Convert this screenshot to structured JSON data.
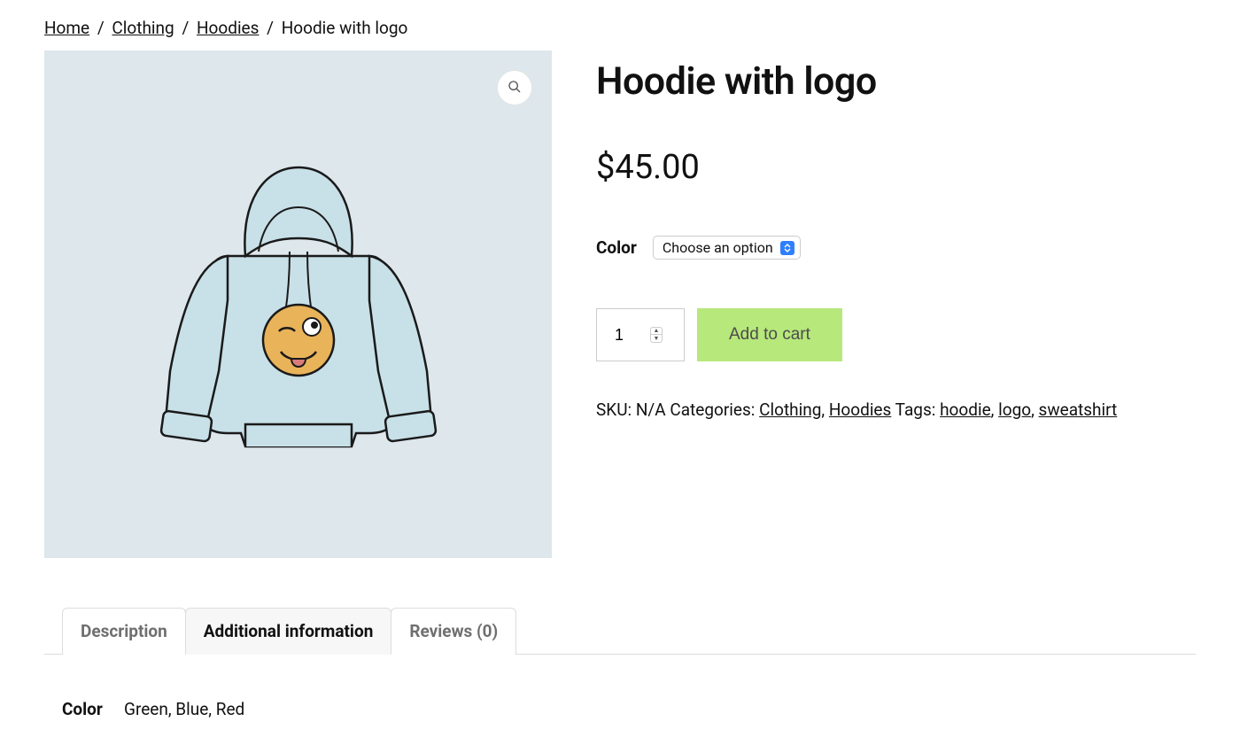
{
  "breadcrumb": {
    "home": "Home",
    "clothing": "Clothing",
    "hoodies": "Hoodies",
    "current": "Hoodie with logo",
    "sep": "/"
  },
  "product": {
    "title": "Hoodie with logo",
    "price": "$45.00"
  },
  "variation": {
    "label": "Color",
    "placeholder": "Choose an option"
  },
  "cart": {
    "quantity": "1",
    "add_label": "Add to cart"
  },
  "meta": {
    "sku_label": "SKU:",
    "sku_value": "N/A",
    "categories_label": "Categories:",
    "category_clothing": "Clothing",
    "category_hoodies": "Hoodies",
    "tags_label": "Tags:",
    "tag_hoodie": "hoodie",
    "tag_logo": "logo",
    "tag_sweatshirt": "sweatshirt",
    "comma": ", "
  },
  "tabs": {
    "description": "Description",
    "additional": "Additional information",
    "reviews": "Reviews (0)"
  },
  "additional": {
    "color_label": "Color",
    "color_values": "Green, Blue, Red"
  }
}
